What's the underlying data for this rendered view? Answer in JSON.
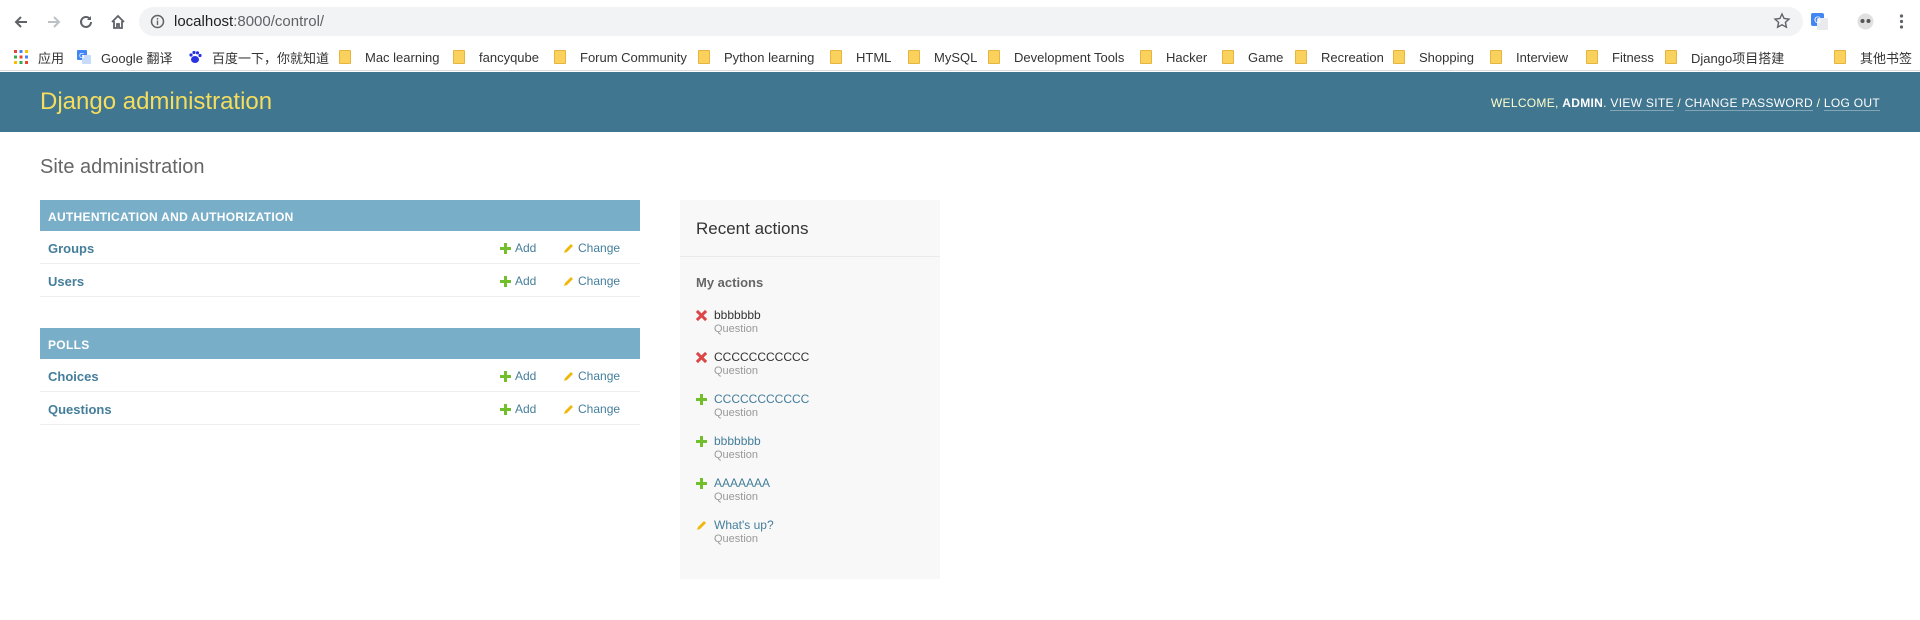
{
  "browser": {
    "url_host": "localhost",
    "url_rest": ":8000/control/"
  },
  "bookmarks": [
    {
      "label": "应用",
      "icon": "apps-grid-icon"
    },
    {
      "label": "Google 翻译",
      "icon": "google-translate-icon"
    },
    {
      "label": "百度一下，你就知道",
      "icon": "baidu-icon"
    },
    {
      "label": "Mac learning",
      "icon": "folder-icon"
    },
    {
      "label": "fancyqube",
      "icon": "folder-icon"
    },
    {
      "label": "Forum Community",
      "icon": "folder-icon"
    },
    {
      "label": "Python learning",
      "icon": "folder-icon"
    },
    {
      "label": "HTML",
      "icon": "folder-icon"
    },
    {
      "label": "MySQL",
      "icon": "folder-icon"
    },
    {
      "label": "Development Tools",
      "icon": "folder-icon"
    },
    {
      "label": "Hacker",
      "icon": "folder-icon"
    },
    {
      "label": "Game",
      "icon": "folder-icon"
    },
    {
      "label": "Recreation",
      "icon": "folder-icon"
    },
    {
      "label": "Shopping",
      "icon": "folder-icon"
    },
    {
      "label": "Interview",
      "icon": "folder-icon"
    },
    {
      "label": "Fitness",
      "icon": "folder-icon"
    },
    {
      "label": "Django项目搭建",
      "icon": "folder-icon"
    },
    {
      "label": "其他书签",
      "icon": "folder-icon"
    }
  ],
  "header": {
    "branding": "Django administration",
    "welcome": "WELCOME, ",
    "user": "ADMIN",
    "after_user": ". ",
    "view_site": "VIEW SITE",
    "sep": " / ",
    "change_password": "CHANGE PASSWORD",
    "log_out": "LOG OUT"
  },
  "page_title": "Site administration",
  "modules": [
    {
      "caption": "AUTHENTICATION AND AUTHORIZATION",
      "rows": [
        {
          "name": "Groups",
          "add": "Add",
          "change": "Change"
        },
        {
          "name": "Users",
          "add": "Add",
          "change": "Change"
        }
      ]
    },
    {
      "caption": "POLLS",
      "rows": [
        {
          "name": "Choices",
          "add": "Add",
          "change": "Change"
        },
        {
          "name": "Questions",
          "add": "Add",
          "change": "Change"
        }
      ]
    }
  ],
  "recent": {
    "title": "Recent actions",
    "subtitle": "My actions",
    "actions": [
      {
        "object": "bbbbbbb",
        "type": "Question",
        "kind": "deletion"
      },
      {
        "object": "CCCCCCCCCCC",
        "type": "Question",
        "kind": "deletion"
      },
      {
        "object": "CCCCCCCCCCC",
        "type": "Question",
        "kind": "addition"
      },
      {
        "object": "bbbbbbb",
        "type": "Question",
        "kind": "addition"
      },
      {
        "object": "AAAAAAA",
        "type": "Question",
        "kind": "addition"
      },
      {
        "object": "What's up?",
        "type": "Question",
        "kind": "change"
      }
    ]
  }
}
